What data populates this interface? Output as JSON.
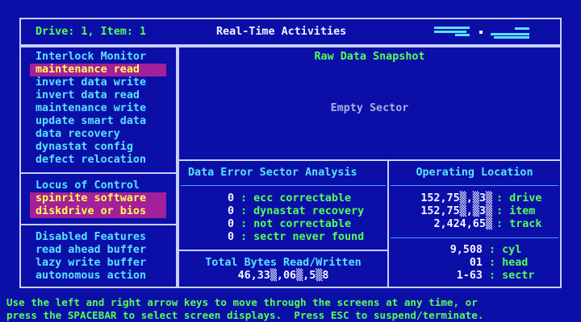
{
  "header": {
    "drive_item": "Drive: 1, Item: 1",
    "title": "Real-Time Activities"
  },
  "interlock": {
    "heading": "Interlock Monitor",
    "items": [
      "maintenance read",
      "invert data write",
      "invert data read",
      "maintenance write",
      "update smart data",
      "data recovery",
      "dynastat config",
      "defect relocation"
    ]
  },
  "locus": {
    "heading": "Locus of Control",
    "items": [
      "spinrite software",
      "diskdrive or bios"
    ]
  },
  "disabled": {
    "heading": "Disabled Features",
    "items": [
      "read ahead buffer",
      "lazy write buffer",
      "autonomous action"
    ]
  },
  "snapshot": {
    "heading": "Raw Data Snapshot",
    "status": "Empty Sector"
  },
  "error_analysis": {
    "heading": "Data Error Sector Analysis",
    "rows": [
      {
        "count": "0",
        "label": "ecc correctable"
      },
      {
        "count": "0",
        "label": "dynastat recovery"
      },
      {
        "count": "0",
        "label": "not correctable"
      },
      {
        "count": "0",
        "label": "sectr never found"
      }
    ]
  },
  "bytes": {
    "heading": "Total Bytes Read/Written",
    "value": "46,33▒,06▒,5▒8"
  },
  "location": {
    "heading": "Operating Location",
    "rows": [
      {
        "value": "152,75▒,▒3▒",
        "label": "drive"
      },
      {
        "value": "152,75▒,▒3▒",
        "label": "item"
      },
      {
        "value": "2,424,65▒",
        "label": "track"
      }
    ],
    "geometry": [
      {
        "value": "9,508",
        "label": "cyl"
      },
      {
        "value": "01",
        "label": "head"
      },
      {
        "value": "1-63",
        "label": "sectr"
      }
    ]
  },
  "footer": {
    "line1": "Use the left and right arrow keys to move through the screens at any time, or",
    "line2": "press the SPACEBAR to select screen displays.  Press ESC to suspend/terminate."
  }
}
